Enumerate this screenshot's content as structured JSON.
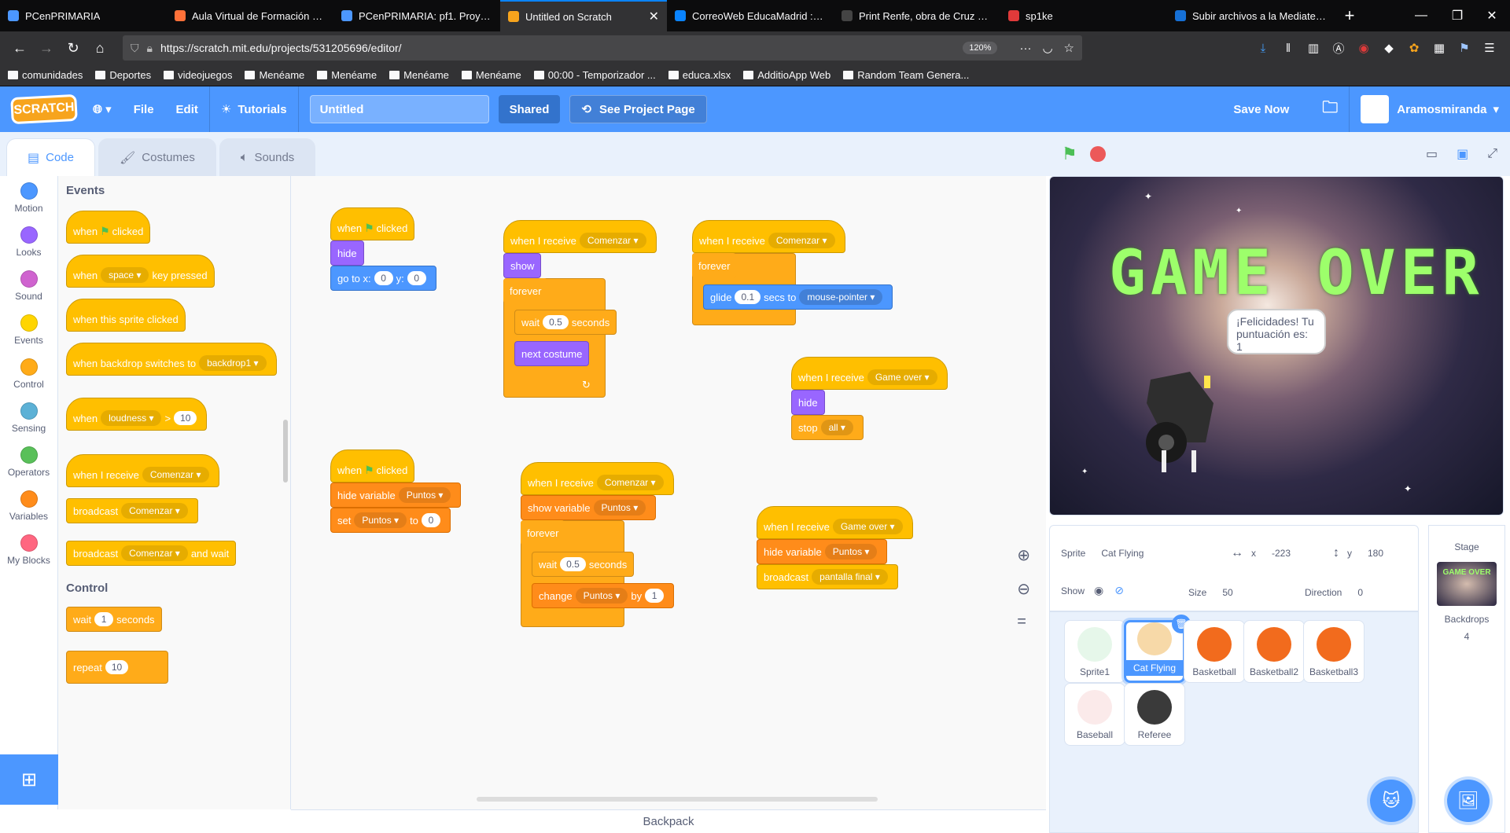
{
  "browser": {
    "tabs": [
      {
        "title": "PCenPRIMARIA",
        "color": "#4c97ff"
      },
      {
        "title": "Aula Virtual de Formación en lín",
        "color": "#ff7139"
      },
      {
        "title": "PCenPRIMARIA: pf1. Proyecto fin",
        "color": "#4c97ff"
      },
      {
        "title": "Untitled on Scratch",
        "color": "#f7a41d",
        "active": true
      },
      {
        "title": "CorreoWeb EducaMadrid :: INBO",
        "color": "#0a84ff"
      },
      {
        "title": "Print Renfe, obra de Cruz Noville",
        "color": "#444444"
      },
      {
        "title": "sp1ke",
        "color": "#e03a3a"
      },
      {
        "title": "Subir archivos a la Mediateca | M",
        "color": "#1670d6"
      }
    ],
    "url": "https://scratch.mit.edu/projects/531205696/editor/",
    "zoom": "120%",
    "bookmarks": [
      "comunidades",
      "Deportes",
      "videojuegos",
      "Menéame",
      "Menéame",
      "Menéame",
      "Menéame",
      "00:00 - Temporizador ...",
      "educa.xlsx",
      "AdditioApp Web",
      "Random Team Genera..."
    ]
  },
  "menubar": {
    "logo": "SCRATCH",
    "file": "File",
    "edit": "Edit",
    "tutorials": "Tutorials",
    "project_title": "Untitled",
    "shared": "Shared",
    "see_project_page": "See Project Page",
    "save_now": "Save Now",
    "username": "Aramosmiranda"
  },
  "editor_tabs": {
    "code": "Code",
    "costumes": "Costumes",
    "sounds": "Sounds"
  },
  "categories": [
    {
      "label": "Motion",
      "color": "#4c97ff"
    },
    {
      "label": "Looks",
      "color": "#9966ff"
    },
    {
      "label": "Sound",
      "color": "#cf63cf"
    },
    {
      "label": "Events",
      "color": "#ffd500"
    },
    {
      "label": "Control",
      "color": "#ffab19"
    },
    {
      "label": "Sensing",
      "color": "#5cb1d6"
    },
    {
      "label": "Operators",
      "color": "#59c059"
    },
    {
      "label": "Variables",
      "color": "#ff8c1a"
    },
    {
      "label": "My Blocks",
      "color": "#ff6680"
    }
  ],
  "palette": {
    "events_title": "Events",
    "control_title": "Control",
    "when": "when",
    "clicked": "clicked",
    "space": "space",
    "key_pressed": "key pressed",
    "when_sprite_clicked": "when this sprite clicked",
    "when_backdrop": "when backdrop switches to",
    "backdrop1": "backdrop1",
    "loudness": "loudness",
    "gt": ">",
    "ten": "10",
    "when_i_receive": "when I receive",
    "comenzar": "Comenzar",
    "broadcast": "broadcast",
    "and_wait": "and wait",
    "wait": "wait",
    "one": "1",
    "seconds": "seconds",
    "repeat": "repeat"
  },
  "scripts": {
    "when": "when",
    "clicked": "clicked",
    "hide": "hide",
    "show": "show",
    "go_to_x": "go to x:",
    "y": "y:",
    "zero": "0",
    "when_i_receive": "when I receive",
    "comenzar": "Comenzar",
    "game_over": "Game over",
    "forever": "forever",
    "wait": "wait",
    "half": "0.5",
    "seconds": "seconds",
    "next_costume": "next costume",
    "glide": "glide",
    "glide_secs": "0.1",
    "secs_to": "secs to",
    "mouse_pointer": "mouse-pointer",
    "stop": "stop",
    "all": "all",
    "hide_variable": "hide variable",
    "show_variable": "show variable",
    "puntos": "Puntos",
    "set": "set",
    "to": "to",
    "change": "change",
    "by": "by",
    "one": "1",
    "broadcast": "broadcast",
    "pantalla_final": "pantalla final"
  },
  "backpack": "Backpack",
  "stage": {
    "game_over_text": "GAME OVER",
    "bubble": "¡Felicidades! Tu puntuación es: 1"
  },
  "sprite_info": {
    "sprite_label": "Sprite",
    "sprite_name": "Cat Flying",
    "x_label": "x",
    "x": "-223",
    "y_label": "y",
    "y": "180",
    "show_label": "Show",
    "size_label": "Size",
    "size": "50",
    "direction_label": "Direction",
    "direction": "0"
  },
  "sprites": [
    {
      "name": "Sprite1",
      "color": "#e6f7ea"
    },
    {
      "name": "Cat Flying",
      "color": "#f7d9a8",
      "selected": true
    },
    {
      "name": "Basketball",
      "color": "#f26b1d"
    },
    {
      "name": "Basketball2",
      "color": "#f26b1d"
    },
    {
      "name": "Basketball3",
      "color": "#f26b1d"
    },
    {
      "name": "Baseball",
      "color": "#fbeaea"
    },
    {
      "name": "Referee",
      "color": "#3a3a3a"
    }
  ],
  "stage_pane": {
    "title": "Stage",
    "thumb_text": "GAME OVER",
    "backdrops_label": "Backdrops",
    "backdrops_count": "4"
  }
}
